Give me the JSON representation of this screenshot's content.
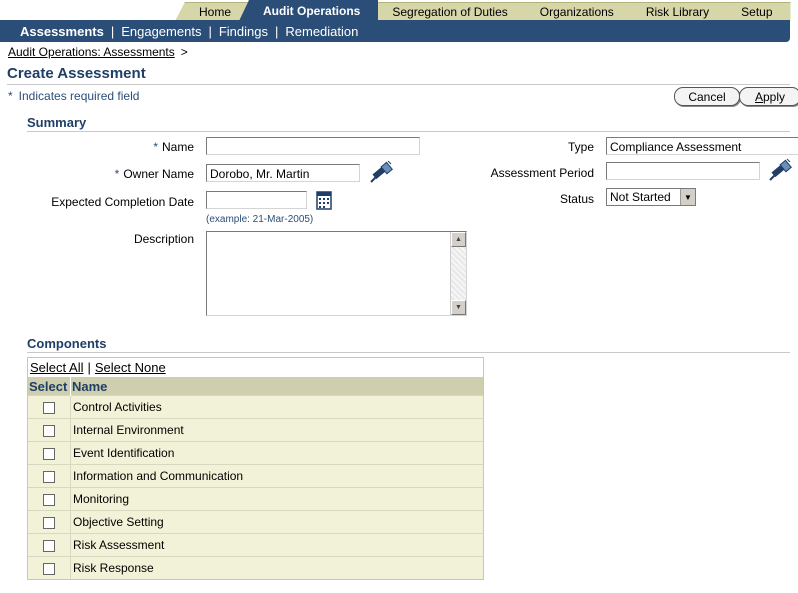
{
  "tabs": [
    {
      "label": "Home",
      "active": false
    },
    {
      "label": "Audit Operations",
      "active": true
    },
    {
      "label": "Segregation of Duties",
      "active": false
    },
    {
      "label": "Organizations",
      "active": false
    },
    {
      "label": "Risk Library",
      "active": false
    },
    {
      "label": "Setup",
      "active": false
    }
  ],
  "subnav": [
    "Assessments",
    "Engagements",
    "Findings",
    "Remediation"
  ],
  "breadcrumb": {
    "link": "Audit Operations: Assessments",
    "sep": ">"
  },
  "page_title": "Create Assessment",
  "required_note": {
    "star": "*",
    "text": "Indicates required field"
  },
  "buttons": {
    "cancel": "Cancel",
    "apply_a": "A",
    "apply_rest": "pply"
  },
  "summary": {
    "title": "Summary",
    "star": "*",
    "name_label": "Name",
    "name_value": "",
    "owner_label": "Owner Name",
    "owner_value": "Dorobo, Mr. Martin",
    "completion_label": "Expected Completion Date",
    "completion_value": "",
    "completion_hint": "(example: 21-Mar-2005)",
    "description_label": "Description",
    "type_label": "Type",
    "type_value": "Compliance Assessment",
    "period_label": "Assessment Period",
    "period_value": "",
    "status_label": "Status",
    "status_value": "Not Started"
  },
  "components": {
    "title": "Components",
    "select_all": "Select All",
    "select_none": "Select None",
    "col_select": "Select",
    "col_name": "Name",
    "rows": [
      "Control Activities",
      "Internal Environment",
      "Event Identification",
      "Information and Communication",
      "Monitoring",
      "Objective Setting",
      "Risk Assessment",
      "Risk Response"
    ]
  },
  "colors": {
    "brand": "#2b4e78",
    "tab": "#d6d6a8",
    "table_header": "#cfcfb0",
    "table_row": "#f2f2d8"
  }
}
